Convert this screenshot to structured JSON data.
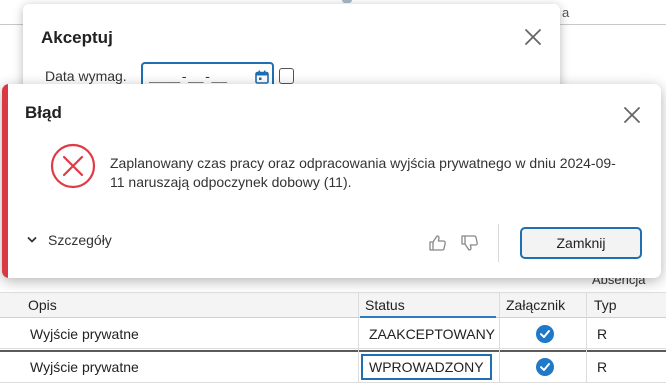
{
  "background": {
    "top_fragment": "a",
    "right_column_texts": [
      "Absencja"
    ],
    "grid": {
      "columns": [
        "Opis",
        "Status",
        "Załącznik",
        "Typ"
      ],
      "rows": [
        {
          "opis": "Wyjście prywatne",
          "status": "ZAAKCEPTOWANY",
          "attachment": "check-circle-icon",
          "typ": "R"
        },
        {
          "opis": "Wyjście prywatne",
          "status": "WPROWADZONY",
          "attachment": "check-circle-icon",
          "typ": "R"
        }
      ]
    }
  },
  "accept_dialog": {
    "title": "Akceptuj",
    "date_label": "Data wymag.",
    "date_value": "____-__-__"
  },
  "error_dialog": {
    "title": "Błąd",
    "message": "Zaplanowany czas pracy oraz odpracowania wyjścia prywatnego w dniu 2024-09-11 naruszają odpoczynek dobowy (11).",
    "details_label": "Szczegóły",
    "close_button": "Zamknij"
  },
  "colors": {
    "accent": "#1f6fb2",
    "error": "#d83a44",
    "check": "#1f78c8"
  }
}
